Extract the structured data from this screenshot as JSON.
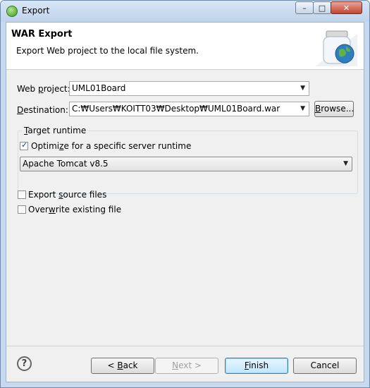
{
  "window": {
    "title": "Export",
    "controls": {
      "minimize": "–",
      "maximize": "□",
      "close": "✕"
    }
  },
  "header": {
    "title": "WAR Export",
    "description": "Export Web project to the local file system.",
    "icon": "war-jar-globe-icon"
  },
  "web_project": {
    "label_pre": "Web ",
    "label_mnemonic": "p",
    "label_post": "roject:",
    "value": "UML01Board"
  },
  "destination": {
    "label_mnemonic": "D",
    "label_post": "estination:",
    "value": "C:₩Users₩KOITT03₩Desktop₩UML01Board.war",
    "browse_mnemonic": "B",
    "browse_post": "rowse..."
  },
  "target_runtime": {
    "group_mnemonic": "T",
    "group_post": "arget runtime",
    "optimize_pre": "Optimi",
    "optimize_mnemonic": "z",
    "optimize_post": "e for a specific server runtime",
    "optimize_checked": true,
    "server": "Apache Tomcat v8.5"
  },
  "options": {
    "export_source_pre": "Export ",
    "export_source_mnemonic": "s",
    "export_source_post": "ource files",
    "export_source_checked": false,
    "overwrite_pre": "Over",
    "overwrite_mnemonic": "w",
    "overwrite_post": "rite existing file",
    "overwrite_checked": false
  },
  "buttons": {
    "help": "?",
    "back_pre": "< ",
    "back_mnemonic": "B",
    "back_post": "ack",
    "next_pre": "",
    "next_mnemonic": "N",
    "next_post": "ext >",
    "finish_mnemonic": "F",
    "finish_post": "inish",
    "cancel": "Cancel"
  }
}
